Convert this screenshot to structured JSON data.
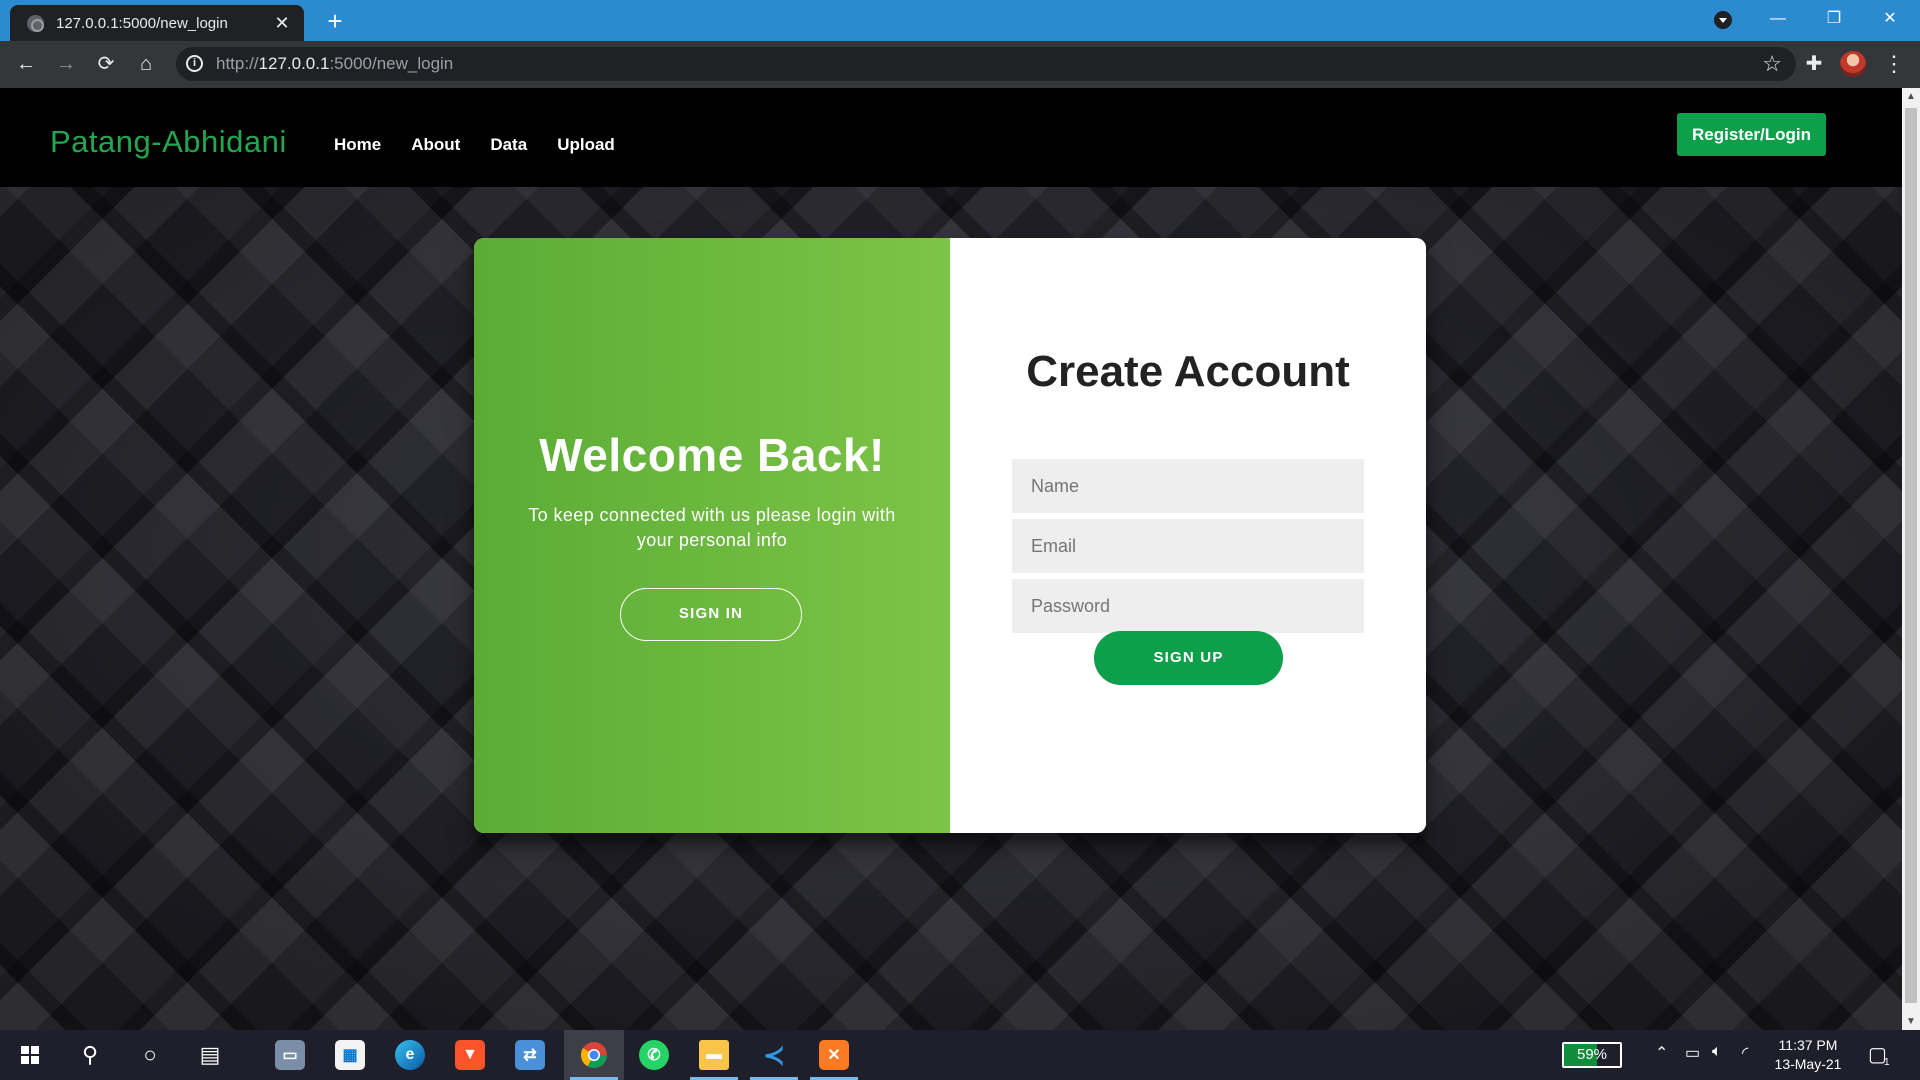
{
  "browser": {
    "tab_title": "127.0.0.1:5000/new_login",
    "url_scheme": "http://",
    "url_host": "127.0.0.1",
    "url_path": ":5000/new_login"
  },
  "site": {
    "brand": "Patang-Abhidani",
    "nav": [
      "Home",
      "About",
      "Data",
      "Upload"
    ],
    "register_label": "Register/Login"
  },
  "overlay": {
    "title": "Welcome Back!",
    "text": "To keep connected with us please login with your personal info",
    "button": "SIGN IN"
  },
  "form": {
    "title": "Create Account",
    "name_placeholder": "Name",
    "email_placeholder": "Email",
    "password_placeholder": "Password",
    "button": "SIGN UP"
  },
  "taskbar": {
    "apps": [
      "start-icon",
      "search-icon",
      "cortana-icon",
      "task-view-icon",
      "remote-desktop-icon",
      "microsoft-store-icon",
      "edge-icon",
      "brave-icon",
      "network-app-icon",
      "chrome-icon",
      "whatsapp-icon",
      "file-explorer-icon",
      "vscode-icon",
      "xampp-icon"
    ],
    "battery": "59%",
    "time": "11:37 PM",
    "date": "13-May-21",
    "notification_count": "1"
  },
  "colors": {
    "accent_green": "#0e9f4b",
    "brand_green": "#22a74f",
    "overlay_gradient_start": "#5aac35",
    "overlay_gradient_end": "#7dc447",
    "chrome_titlebar": "#2b8ad0"
  }
}
